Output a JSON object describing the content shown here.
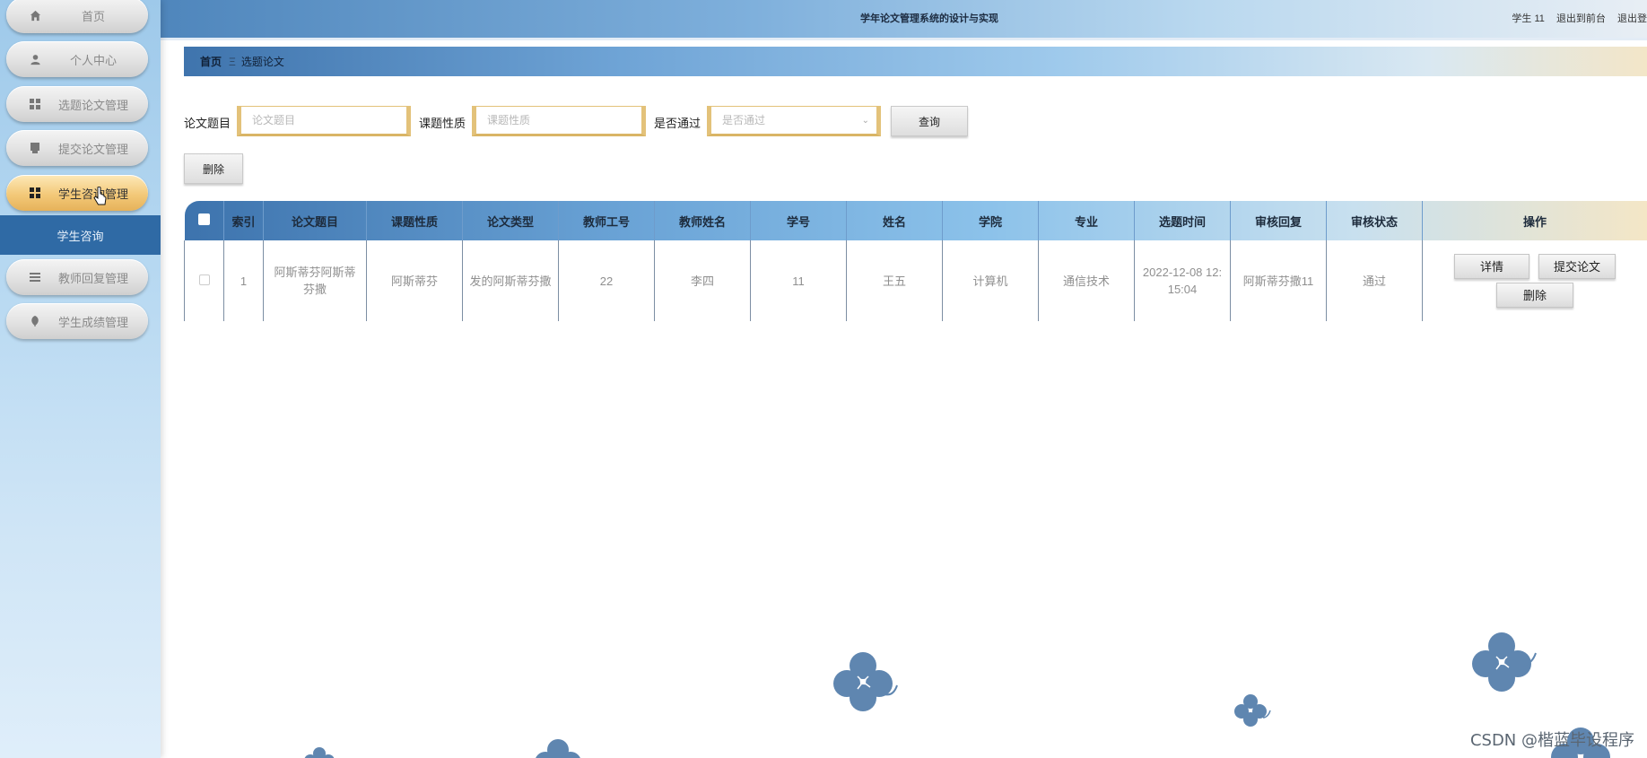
{
  "app": {
    "title": "学年论文管理系统的设计与实现",
    "user_label": "学生 11",
    "link_frontend": "退出到前台",
    "link_logout": "退出登"
  },
  "sidebar": {
    "items": [
      {
        "label": "首页",
        "icon": "home-icon"
      },
      {
        "label": "个人中心",
        "icon": "user-icon"
      },
      {
        "label": "选题论文管理",
        "icon": "grid-icon"
      },
      {
        "label": "提交论文管理",
        "icon": "document-icon"
      },
      {
        "label": "学生咨询管理",
        "icon": "grid-icon",
        "active": true
      },
      {
        "label": "教师回复管理",
        "icon": "list-icon"
      },
      {
        "label": "学生成绩管理",
        "icon": "leaf-icon"
      }
    ],
    "submenu": {
      "label": "学生咨询"
    }
  },
  "breadcrumb": {
    "home": "首页",
    "separator": "Ξ",
    "current": "选题论文"
  },
  "search": {
    "title_label": "论文题目",
    "title_placeholder": "论文题目",
    "nature_label": "课题性质",
    "nature_placeholder": "课题性质",
    "passed_label": "是否通过",
    "passed_placeholder": "是否通过",
    "query_button": "查询",
    "delete_button": "删除"
  },
  "table": {
    "headers": [
      "",
      "索引",
      "论文题目",
      "课题性质",
      "论文类型",
      "教师工号",
      "教师姓名",
      "学号",
      "姓名",
      "学院",
      "专业",
      "选题时间",
      "审核回复",
      "审核状态",
      "操作"
    ],
    "rows": [
      {
        "index": "1",
        "title": "阿斯蒂芬阿斯蒂芬撒",
        "nature": "阿斯蒂芬",
        "type": "发的阿斯蒂芬撒",
        "teacher_id": "22",
        "teacher_name": "李四",
        "student_id": "11",
        "name": "王五",
        "college": "计算机",
        "major": "通信技术",
        "time": "2022-12-08 12:15:04",
        "reply": "阿斯蒂芬撒11",
        "status": "通过",
        "actions": {
          "detail": "详情",
          "submit": "提交论文",
          "delete": "删除"
        }
      }
    ]
  },
  "colors": {
    "accent_gold": "#e3c27a",
    "sidebar_active": "#f3c979",
    "submenu_bg": "#2f6aa5",
    "flower": "#5f86b0"
  },
  "watermark": "CSDN @楷蓝毕设程序"
}
